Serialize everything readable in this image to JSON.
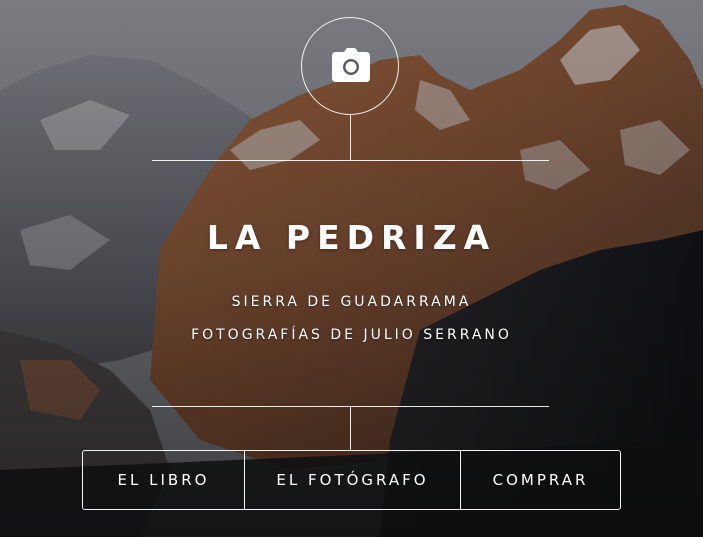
{
  "hero": {
    "title": "LA PEDRIZA",
    "subtitle_line1": "SIERRA DE GUADARRAMA",
    "subtitle_line2": "FOTOGRAFÍAS DE JULIO SERRANO",
    "background": "snowy granite mountain peaks"
  },
  "nav": {
    "items": [
      {
        "label": "EL LIBRO"
      },
      {
        "label": "EL FOTÓGRAFO"
      },
      {
        "label": "COMPRAR"
      }
    ]
  },
  "icons": {
    "camera": "camera-icon"
  },
  "colors": {
    "sky": "#8a8d93",
    "rock_warm": "#8c5a3a",
    "rock_dark": "#3a3430",
    "shadow": "#15171b",
    "snow": "#d8d8da",
    "text": "#ffffff"
  }
}
